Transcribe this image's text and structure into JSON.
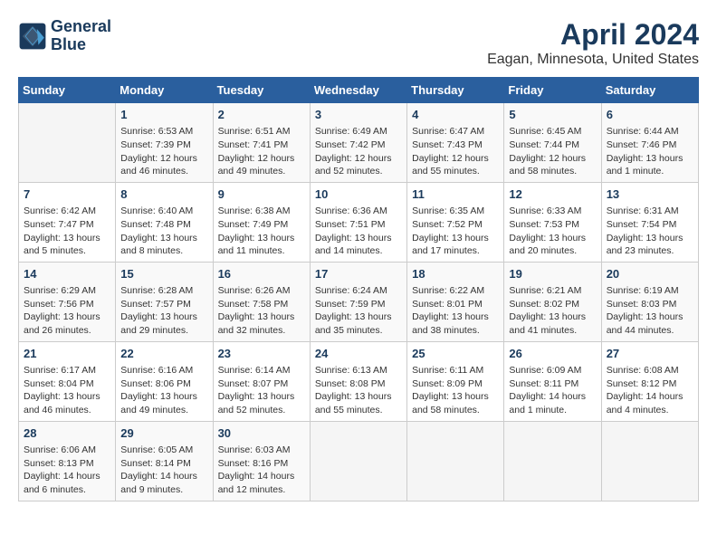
{
  "logo": {
    "line1": "General",
    "line2": "Blue"
  },
  "title": "April 2024",
  "subtitle": "Eagan, Minnesota, United States",
  "days_header": [
    "Sunday",
    "Monday",
    "Tuesday",
    "Wednesday",
    "Thursday",
    "Friday",
    "Saturday"
  ],
  "weeks": [
    [
      {
        "num": "",
        "info": ""
      },
      {
        "num": "1",
        "info": "Sunrise: 6:53 AM\nSunset: 7:39 PM\nDaylight: 12 hours\nand 46 minutes."
      },
      {
        "num": "2",
        "info": "Sunrise: 6:51 AM\nSunset: 7:41 PM\nDaylight: 12 hours\nand 49 minutes."
      },
      {
        "num": "3",
        "info": "Sunrise: 6:49 AM\nSunset: 7:42 PM\nDaylight: 12 hours\nand 52 minutes."
      },
      {
        "num": "4",
        "info": "Sunrise: 6:47 AM\nSunset: 7:43 PM\nDaylight: 12 hours\nand 55 minutes."
      },
      {
        "num": "5",
        "info": "Sunrise: 6:45 AM\nSunset: 7:44 PM\nDaylight: 12 hours\nand 58 minutes."
      },
      {
        "num": "6",
        "info": "Sunrise: 6:44 AM\nSunset: 7:46 PM\nDaylight: 13 hours\nand 1 minute."
      }
    ],
    [
      {
        "num": "7",
        "info": "Sunrise: 6:42 AM\nSunset: 7:47 PM\nDaylight: 13 hours\nand 5 minutes."
      },
      {
        "num": "8",
        "info": "Sunrise: 6:40 AM\nSunset: 7:48 PM\nDaylight: 13 hours\nand 8 minutes."
      },
      {
        "num": "9",
        "info": "Sunrise: 6:38 AM\nSunset: 7:49 PM\nDaylight: 13 hours\nand 11 minutes."
      },
      {
        "num": "10",
        "info": "Sunrise: 6:36 AM\nSunset: 7:51 PM\nDaylight: 13 hours\nand 14 minutes."
      },
      {
        "num": "11",
        "info": "Sunrise: 6:35 AM\nSunset: 7:52 PM\nDaylight: 13 hours\nand 17 minutes."
      },
      {
        "num": "12",
        "info": "Sunrise: 6:33 AM\nSunset: 7:53 PM\nDaylight: 13 hours\nand 20 minutes."
      },
      {
        "num": "13",
        "info": "Sunrise: 6:31 AM\nSunset: 7:54 PM\nDaylight: 13 hours\nand 23 minutes."
      }
    ],
    [
      {
        "num": "14",
        "info": "Sunrise: 6:29 AM\nSunset: 7:56 PM\nDaylight: 13 hours\nand 26 minutes."
      },
      {
        "num": "15",
        "info": "Sunrise: 6:28 AM\nSunset: 7:57 PM\nDaylight: 13 hours\nand 29 minutes."
      },
      {
        "num": "16",
        "info": "Sunrise: 6:26 AM\nSunset: 7:58 PM\nDaylight: 13 hours\nand 32 minutes."
      },
      {
        "num": "17",
        "info": "Sunrise: 6:24 AM\nSunset: 7:59 PM\nDaylight: 13 hours\nand 35 minutes."
      },
      {
        "num": "18",
        "info": "Sunrise: 6:22 AM\nSunset: 8:01 PM\nDaylight: 13 hours\nand 38 minutes."
      },
      {
        "num": "19",
        "info": "Sunrise: 6:21 AM\nSunset: 8:02 PM\nDaylight: 13 hours\nand 41 minutes."
      },
      {
        "num": "20",
        "info": "Sunrise: 6:19 AM\nSunset: 8:03 PM\nDaylight: 13 hours\nand 44 minutes."
      }
    ],
    [
      {
        "num": "21",
        "info": "Sunrise: 6:17 AM\nSunset: 8:04 PM\nDaylight: 13 hours\nand 46 minutes."
      },
      {
        "num": "22",
        "info": "Sunrise: 6:16 AM\nSunset: 8:06 PM\nDaylight: 13 hours\nand 49 minutes."
      },
      {
        "num": "23",
        "info": "Sunrise: 6:14 AM\nSunset: 8:07 PM\nDaylight: 13 hours\nand 52 minutes."
      },
      {
        "num": "24",
        "info": "Sunrise: 6:13 AM\nSunset: 8:08 PM\nDaylight: 13 hours\nand 55 minutes."
      },
      {
        "num": "25",
        "info": "Sunrise: 6:11 AM\nSunset: 8:09 PM\nDaylight: 13 hours\nand 58 minutes."
      },
      {
        "num": "26",
        "info": "Sunrise: 6:09 AM\nSunset: 8:11 PM\nDaylight: 14 hours\nand 1 minute."
      },
      {
        "num": "27",
        "info": "Sunrise: 6:08 AM\nSunset: 8:12 PM\nDaylight: 14 hours\nand 4 minutes."
      }
    ],
    [
      {
        "num": "28",
        "info": "Sunrise: 6:06 AM\nSunset: 8:13 PM\nDaylight: 14 hours\nand 6 minutes."
      },
      {
        "num": "29",
        "info": "Sunrise: 6:05 AM\nSunset: 8:14 PM\nDaylight: 14 hours\nand 9 minutes."
      },
      {
        "num": "30",
        "info": "Sunrise: 6:03 AM\nSunset: 8:16 PM\nDaylight: 14 hours\nand 12 minutes."
      },
      {
        "num": "",
        "info": ""
      },
      {
        "num": "",
        "info": ""
      },
      {
        "num": "",
        "info": ""
      },
      {
        "num": "",
        "info": ""
      }
    ]
  ]
}
